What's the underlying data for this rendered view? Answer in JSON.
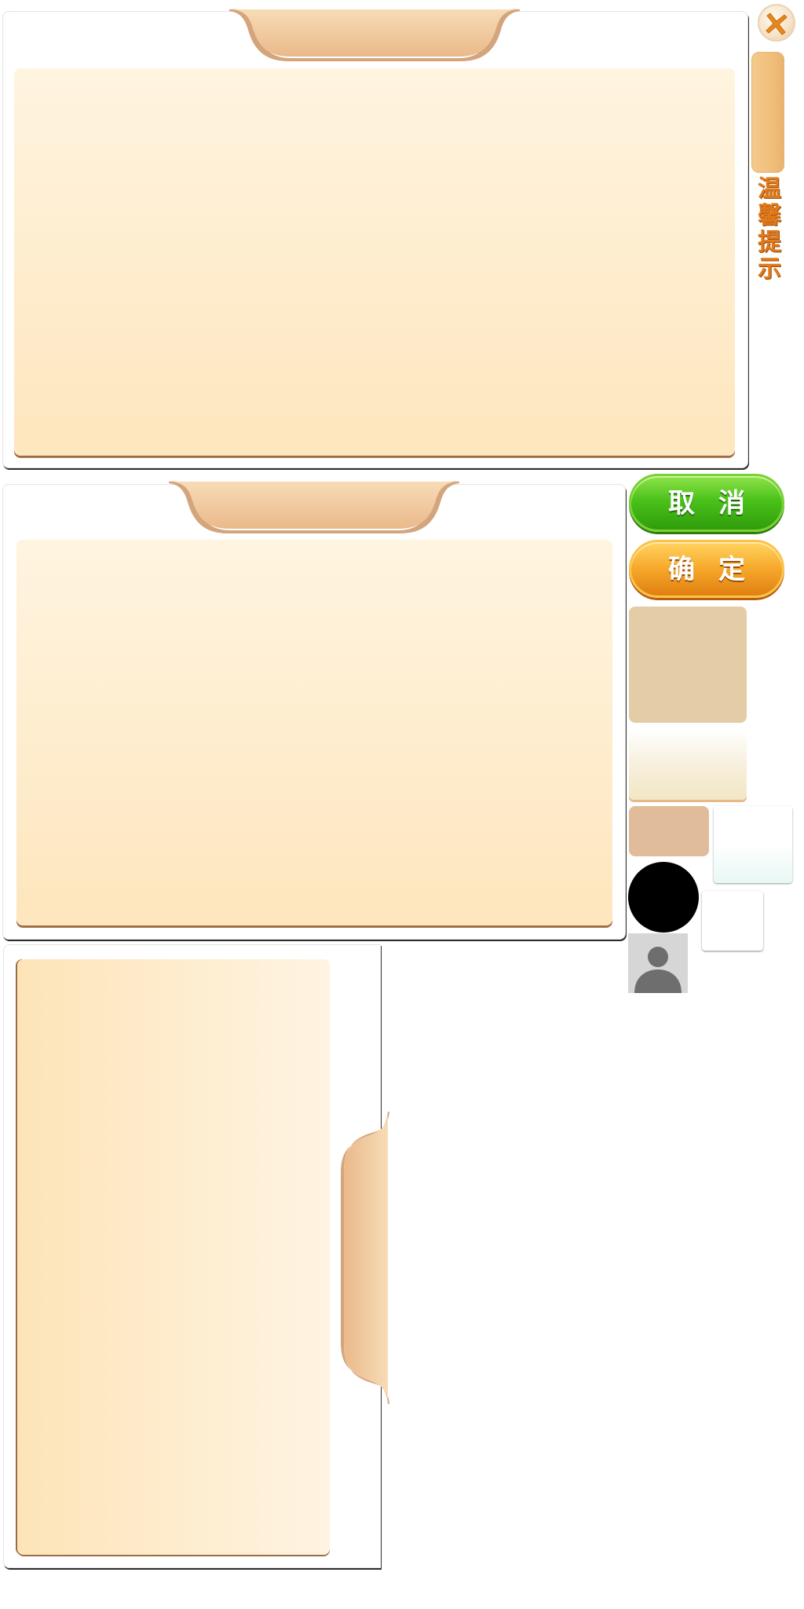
{
  "dialog": {
    "title": "温馨提示"
  },
  "buttons": {
    "cancel_label": "取消",
    "confirm_label": "确定"
  },
  "icons": {
    "close": "close-x-icon",
    "avatar": "user-avatar-icon"
  },
  "colors": {
    "cream_top": "#fff4e0",
    "cream_bottom": "#fee6bd",
    "tab_orange": "#f0bf7a",
    "title_orange": "#e07a1a",
    "green_button": "#4bc21a",
    "orange_button": "#f6a82b",
    "tan_swatch": "#e4cca6",
    "peach_swatch": "#e1bc9b",
    "avatar_gray": "#d6d6d6"
  }
}
